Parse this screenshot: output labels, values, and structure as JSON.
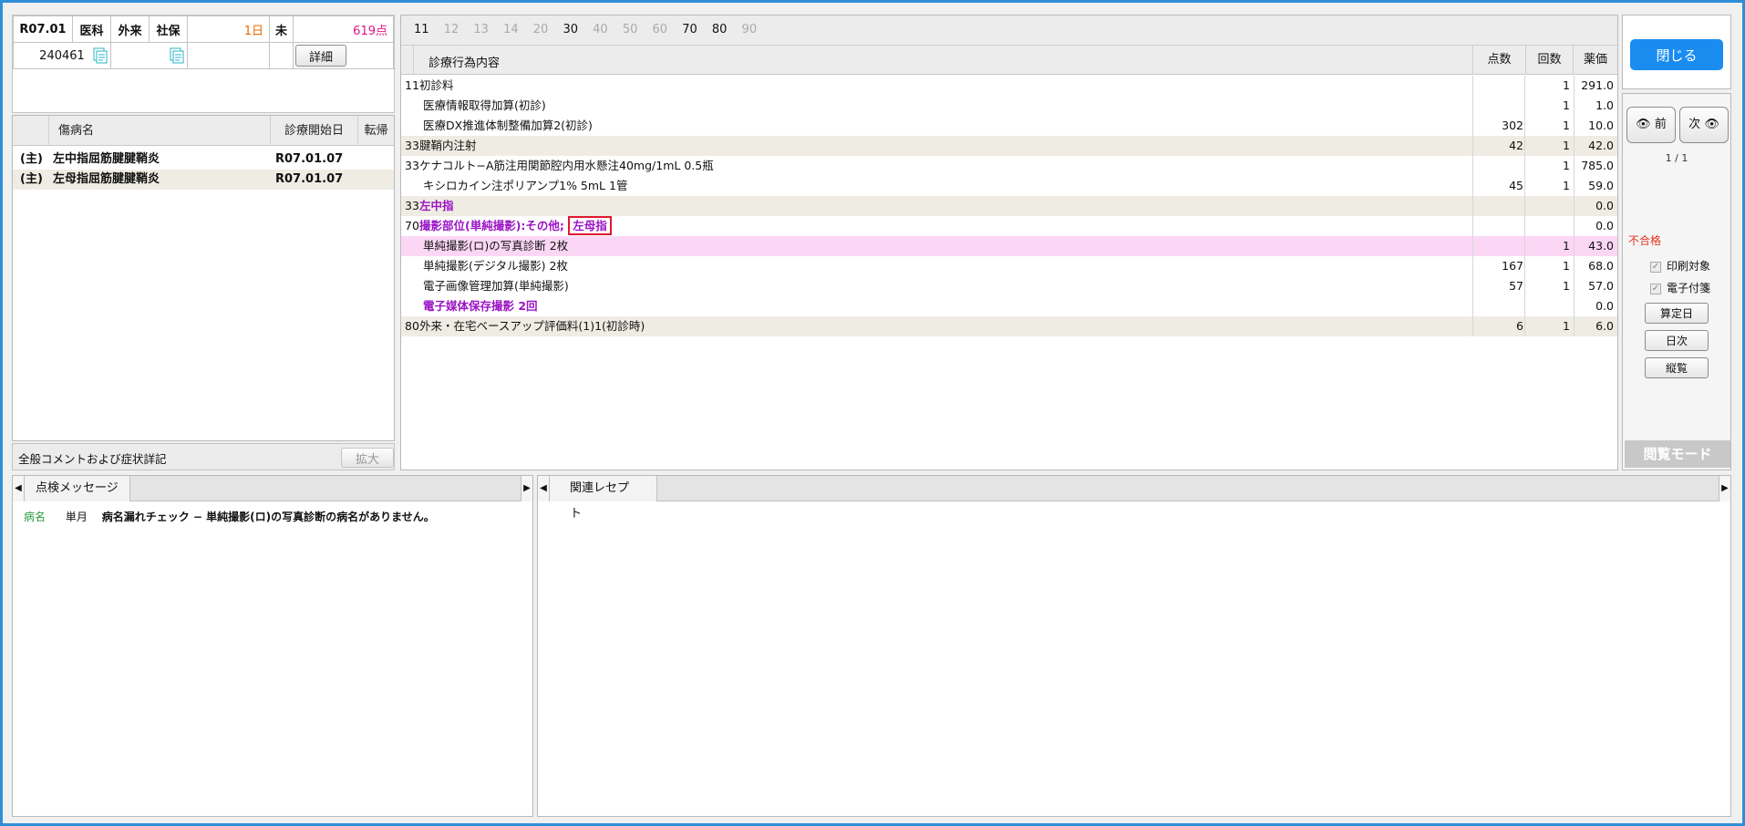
{
  "header": {
    "date": "R07.01",
    "dept": "医科",
    "visit": "外来",
    "insurance": "社保",
    "days": "1日",
    "unpaid": "未",
    "points": "619点",
    "patient_id": "240461",
    "detail_button": "詳細"
  },
  "disease_list": {
    "col_name": "傷病名",
    "col_start": "診療開始日",
    "col_outcome": "転帰",
    "rows": [
      {
        "main": "(主)",
        "name": "左中指屈筋腱腱鞘炎",
        "start": "R07.01.07"
      },
      {
        "main": "(主)",
        "name": "左母指屈筋腱腱鞘炎",
        "start": "R07.01.07"
      }
    ]
  },
  "comment": {
    "label": "全般コメントおよび症状詳記",
    "expand_button": "拡大"
  },
  "main": {
    "tabs": [
      "11",
      "12",
      "13",
      "14",
      "20",
      "30",
      "40",
      "50",
      "60",
      "70",
      "80",
      "90"
    ],
    "active_tabs": [
      "11",
      "30",
      "70",
      "80"
    ],
    "col_content": "診療行為内容",
    "col_points": "点数",
    "col_count": "回数",
    "col_price": "薬価",
    "rows": [
      {
        "code": "11",
        "name": "初診料",
        "points": "",
        "count": "1",
        "price": "291.0"
      },
      {
        "code": "",
        "name": "医療情報取得加算(初診)",
        "points": "",
        "count": "1",
        "price": "1.0"
      },
      {
        "code": "",
        "name": "医療DX推進体制整備加算2(初診)",
        "points": "302",
        "count": "1",
        "price": "10.0"
      },
      {
        "code": "33",
        "name": "腱鞘内注射",
        "points": "42",
        "count": "1",
        "price": "42.0"
      },
      {
        "code": "33",
        "name": "ケナコルト−A筋注用関節腔内用水懸注40mg/1mL 0.5瓶",
        "points": "",
        "count": "1",
        "price": "785.0"
      },
      {
        "code": "",
        "name": "キシロカイン注ポリアンプ1% 5mL 1管",
        "points": "45",
        "count": "1",
        "price": "59.0"
      },
      {
        "code": "33",
        "name": "左中指",
        "points": "",
        "count": "",
        "price": "0.0"
      },
      {
        "code": "70",
        "name": "撮影部位(単純撮影):その他;",
        "name_boxed": "左母指",
        "points": "",
        "count": "",
        "price": "0.0"
      },
      {
        "code": "",
        "name": "単純撮影(ロ)の写真診断 2枚",
        "points": "",
        "count": "1",
        "price": "43.0"
      },
      {
        "code": "",
        "name": "単純撮影(デジタル撮影) 2枚",
        "points": "167",
        "count": "1",
        "price": "68.0"
      },
      {
        "code": "",
        "name": "電子画像管理加算(単純撮影)",
        "points": "57",
        "count": "1",
        "price": "57.0"
      },
      {
        "code": "",
        "name": "電子媒体保存撮影 2回",
        "points": "",
        "count": "",
        "price": "0.0"
      },
      {
        "code": "80",
        "name": "外来・在宅ベースアップ評価料(1)1(初診時)",
        "points": "6",
        "count": "1",
        "price": "6.0"
      }
    ]
  },
  "side": {
    "close_button": "閉じる",
    "prev_button": "前",
    "next_button": "次",
    "page": "1 / 1",
    "status": "不合格",
    "print_target": "印刷対象",
    "e_tag": "電子付箋",
    "calc_date_button": "算定日",
    "daily_button": "日次",
    "overview_button": "縦覧",
    "mode": "閲覧モード"
  },
  "check_panel": {
    "tab": "点検メッセージ",
    "messages": [
      {
        "category": "病名",
        "period": "単月",
        "text": "病名漏れチェック − 単純撮影(ロ)の写真診断の病名がありません。"
      }
    ]
  },
  "related_panel": {
    "tab": "関連レセプト"
  },
  "colors": {
    "accent": "#1a8cf0",
    "purple": "#9b14c4",
    "pink_row": "#fcd7f5",
    "shade_row": "#efede3",
    "alert": "#e0182e"
  }
}
